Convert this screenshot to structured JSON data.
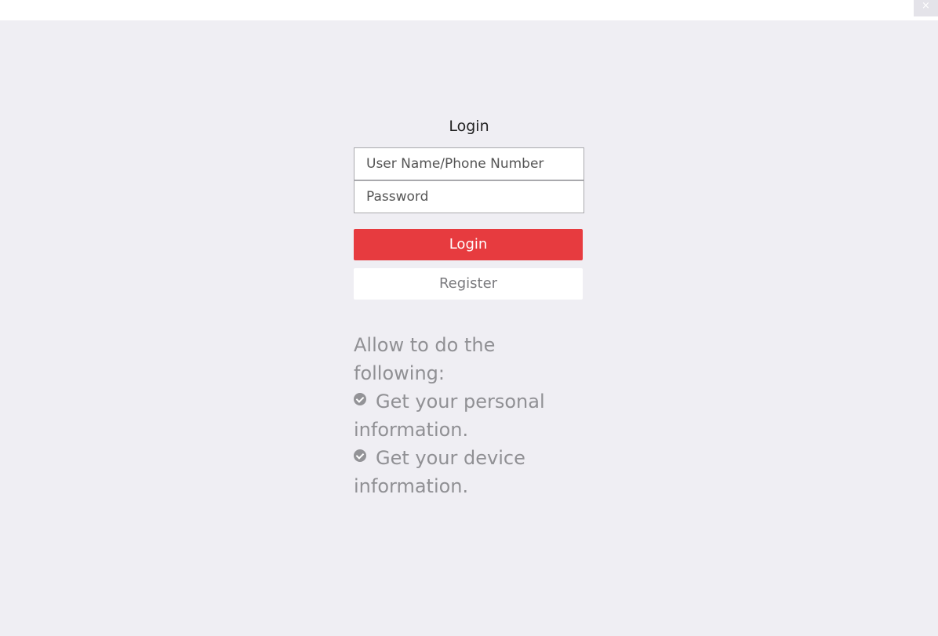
{
  "window": {
    "close_glyph": "×"
  },
  "login": {
    "title": "Login",
    "username_placeholder": "User Name/Phone Number",
    "password_placeholder": "Password",
    "login_button": "Login",
    "register_button": "Register"
  },
  "permissions": {
    "heading": "Allow to do the following:",
    "items": [
      {
        "icon": "check-circle-icon",
        "text": "Get your personal information."
      },
      {
        "icon": "check-circle-icon",
        "text": "Get your device information."
      }
    ]
  },
  "colors": {
    "accent": "#e73b3f",
    "background": "#efeef3",
    "muted_text": "#909094"
  }
}
